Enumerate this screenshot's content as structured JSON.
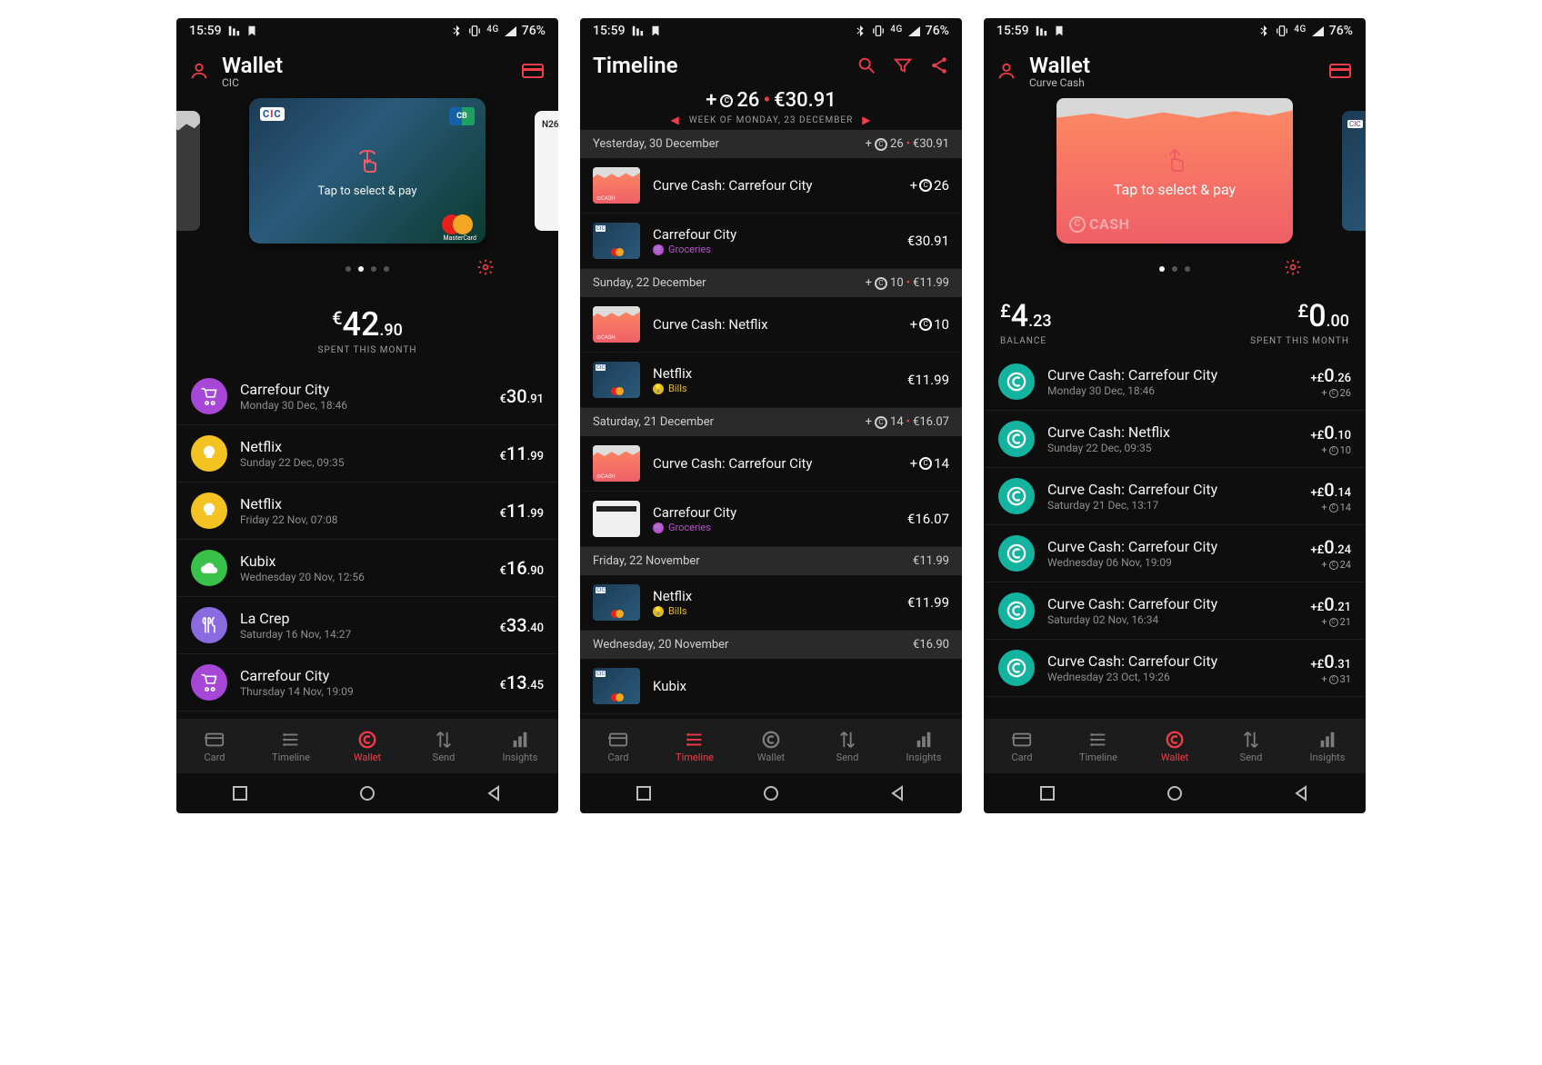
{
  "status": {
    "time": "15:59",
    "network_label": "4G",
    "battery": "76%"
  },
  "colors": {
    "accent": "#f23c49",
    "teal": "#14b3a0"
  },
  "screen1": {
    "title": "Wallet",
    "subtitle": "CIC",
    "card_tap_text": "Tap to select & pay",
    "n26_label": "N26",
    "dots_total": 4,
    "dots_active_index": 1,
    "spent_amount": {
      "currency": "€",
      "whole": "42",
      "frac": ".90"
    },
    "spent_label": "SPENT THIS MONTH",
    "transactions": [
      {
        "icon": "cart",
        "color": "purple",
        "name": "Carrefour City",
        "date": "Monday 30 Dec, 18:46",
        "currency": "€",
        "whole": "30",
        "frac": ".91"
      },
      {
        "icon": "bulb",
        "color": "yellow",
        "name": "Netflix",
        "date": "Sunday 22 Dec, 09:35",
        "currency": "€",
        "whole": "11",
        "frac": ".99"
      },
      {
        "icon": "bulb",
        "color": "yellow",
        "name": "Netflix",
        "date": "Friday 22 Nov, 07:08",
        "currency": "€",
        "whole": "11",
        "frac": ".99"
      },
      {
        "icon": "cloud",
        "color": "green",
        "name": "Kubix",
        "date": "Wednesday 20 Nov, 12:56",
        "currency": "€",
        "whole": "16",
        "frac": ".90"
      },
      {
        "icon": "food",
        "color": "violet",
        "name": "La Crep",
        "date": "Saturday 16 Nov, 14:27",
        "currency": "€",
        "whole": "33",
        "frac": ".40"
      },
      {
        "icon": "cart",
        "color": "purple",
        "name": "Carrefour City",
        "date": "Thursday 14 Nov, 19:09",
        "currency": "€",
        "whole": "13",
        "frac": ".45"
      }
    ],
    "nav_active": "Wallet"
  },
  "screen2": {
    "title": "Timeline",
    "summary_points_prefix": "+ ",
    "summary_points": "26",
    "summary_amount": "€30.91",
    "week_label": "WEEK OF MONDAY, 23 DECEMBER",
    "days": [
      {
        "label": "Yesterday, 30 December",
        "right_points": "26",
        "right_amount": "€30.91",
        "items": [
          {
            "thumb": "cash",
            "name": "Curve Cash: Carrefour City",
            "cat": null,
            "amount_points": "26"
          },
          {
            "thumb": "cic",
            "name": "Carrefour City",
            "cat": "Groceries",
            "cat_type": "groceries",
            "amount": "€30.91"
          }
        ]
      },
      {
        "label": "Sunday, 22 December",
        "right_points": "10",
        "right_amount": "€11.99",
        "items": [
          {
            "thumb": "cash",
            "name": "Curve Cash: Netflix",
            "cat": null,
            "amount_points": "10"
          },
          {
            "thumb": "cic",
            "name": "Netflix",
            "cat": "Bills",
            "cat_type": "bills",
            "amount": "€11.99"
          }
        ]
      },
      {
        "label": "Saturday, 21 December",
        "right_points": "14",
        "right_amount": "€16.07",
        "items": [
          {
            "thumb": "cash",
            "name": "Curve Cash: Carrefour City",
            "cat": null,
            "amount_points": "14"
          },
          {
            "thumb": "n26",
            "name": "Carrefour City",
            "cat": "Groceries",
            "cat_type": "groceries",
            "amount": "€16.07"
          }
        ]
      },
      {
        "label": "Friday, 22 November",
        "right_amount_only": "€11.99",
        "items": [
          {
            "thumb": "cic",
            "name": "Netflix",
            "cat": "Bills",
            "cat_type": "bills",
            "amount": "€11.99"
          }
        ]
      },
      {
        "label": "Wednesday, 20 November",
        "right_amount_only": "€16.90",
        "items": [
          {
            "thumb": "cic",
            "name": "Kubix",
            "cat": null,
            "amount": ""
          }
        ]
      }
    ],
    "nav_active": "Timeline"
  },
  "screen3": {
    "title": "Wallet",
    "subtitle": "Curve Cash",
    "card_tap_text": "Tap to select & pay",
    "cash_brand": "CASH",
    "dots_total": 3,
    "dots_active_index": 0,
    "balance": {
      "currency": "£",
      "whole": "4",
      "frac": ".23",
      "label": "BALANCE"
    },
    "spent": {
      "currency": "£",
      "whole": "0",
      "frac": ".00",
      "label": "SPENT THIS MONTH"
    },
    "transactions": [
      {
        "name": "Curve Cash: Carrefour City",
        "date": "Monday 30 Dec, 18:46",
        "sign": "+",
        "currency": "£",
        "whole": "0",
        "frac": ".26",
        "points": "26"
      },
      {
        "name": "Curve Cash: Netflix",
        "date": "Sunday 22 Dec, 09:35",
        "sign": "+",
        "currency": "£",
        "whole": "0",
        "frac": ".10",
        "points": "10"
      },
      {
        "name": "Curve Cash: Carrefour City",
        "date": "Saturday 21 Dec, 13:17",
        "sign": "+",
        "currency": "£",
        "whole": "0",
        "frac": ".14",
        "points": "14"
      },
      {
        "name": "Curve Cash: Carrefour City",
        "date": "Wednesday 06 Nov, 19:09",
        "sign": "+",
        "currency": "£",
        "whole": "0",
        "frac": ".24",
        "points": "24"
      },
      {
        "name": "Curve Cash: Carrefour City",
        "date": "Saturday 02 Nov, 16:34",
        "sign": "+",
        "currency": "£",
        "whole": "0",
        "frac": ".21",
        "points": "21"
      },
      {
        "name": "Curve Cash: Carrefour City",
        "date": "Wednesday 23 Oct, 19:26",
        "sign": "+",
        "currency": "£",
        "whole": "0",
        "frac": ".31",
        "points": "31"
      }
    ],
    "nav_active": "Wallet"
  },
  "nav_labels": {
    "card": "Card",
    "timeline": "Timeline",
    "wallet": "Wallet",
    "send": "Send",
    "insights": "Insights"
  }
}
